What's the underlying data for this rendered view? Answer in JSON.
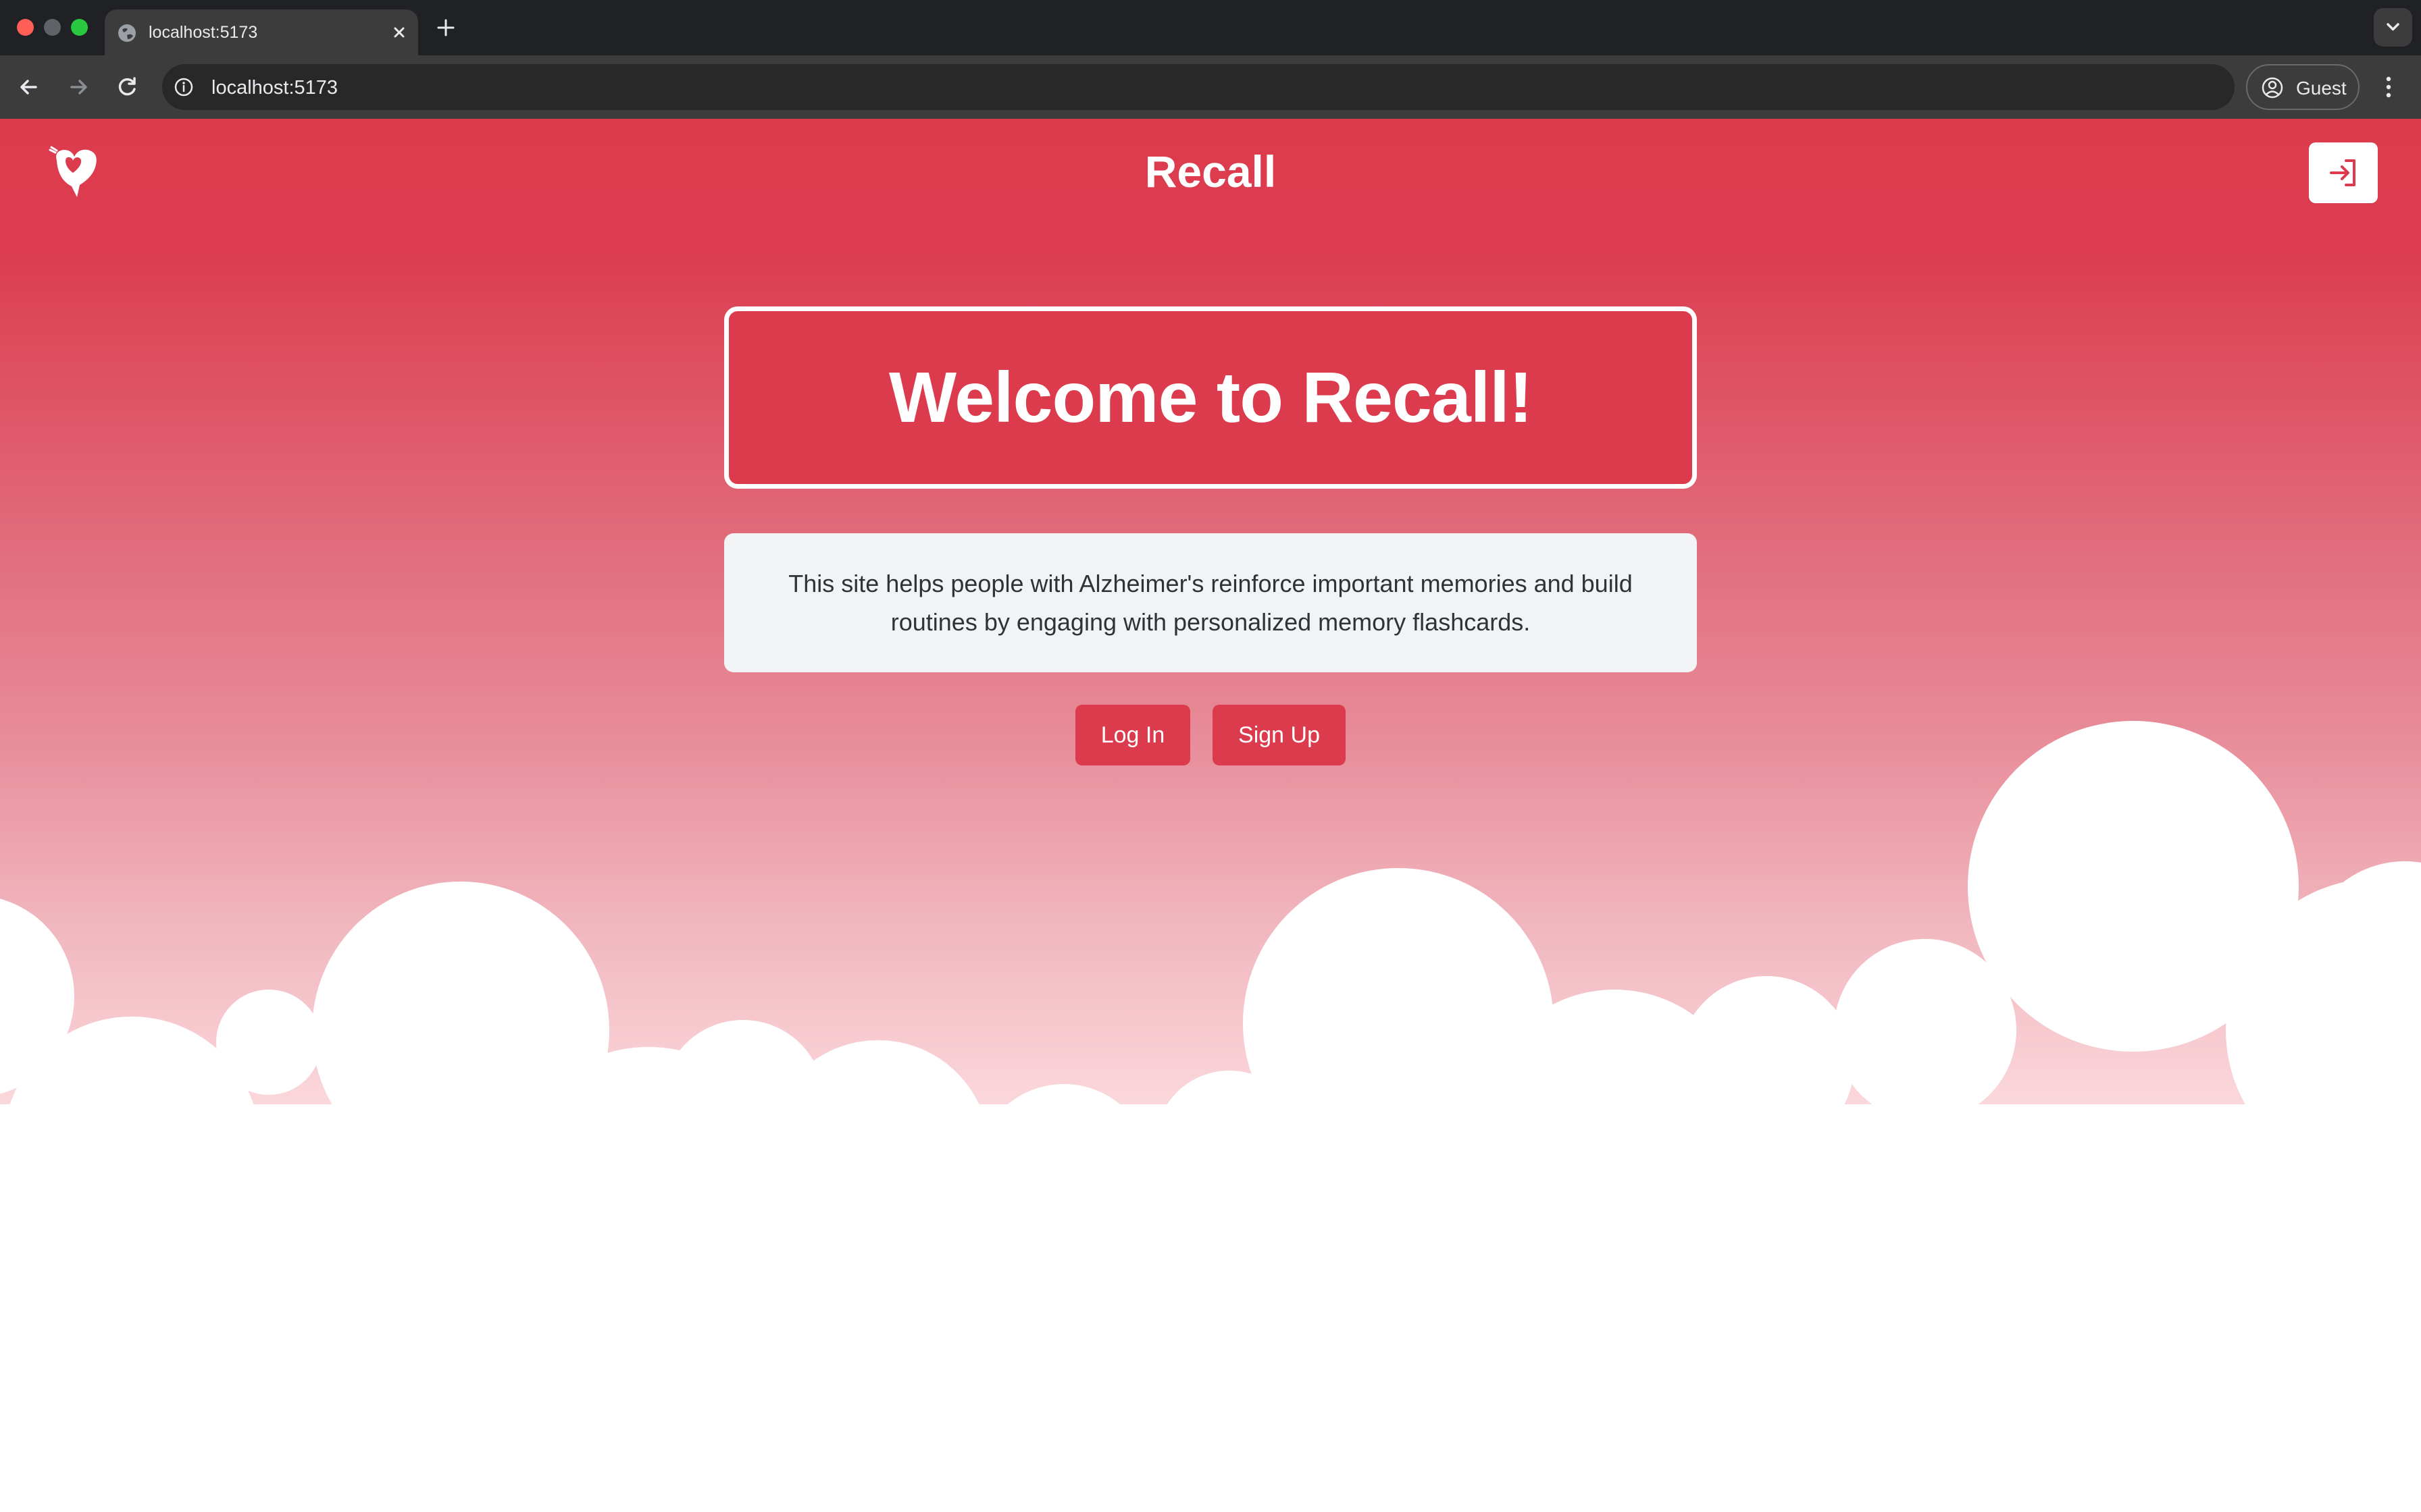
{
  "browser": {
    "tab_title": "localhost:5173",
    "url": "localhost:5173",
    "profile_label": "Guest"
  },
  "page": {
    "site_title": "Recall",
    "welcome_heading": "Welcome to Recall!",
    "description": "This site helps people with Alzheimer's reinforce important memories and build routines by engaging with personalized memory flashcards.",
    "buttons": {
      "login": "Log In",
      "signup": "Sign Up"
    },
    "icons": {
      "logo": "heart-speech-logo",
      "header_action": "login-arrow-icon"
    }
  },
  "colors": {
    "brand_red": "#dc3b4d",
    "card_background": "#f1f3f5",
    "text_dark": "#2f3338"
  }
}
